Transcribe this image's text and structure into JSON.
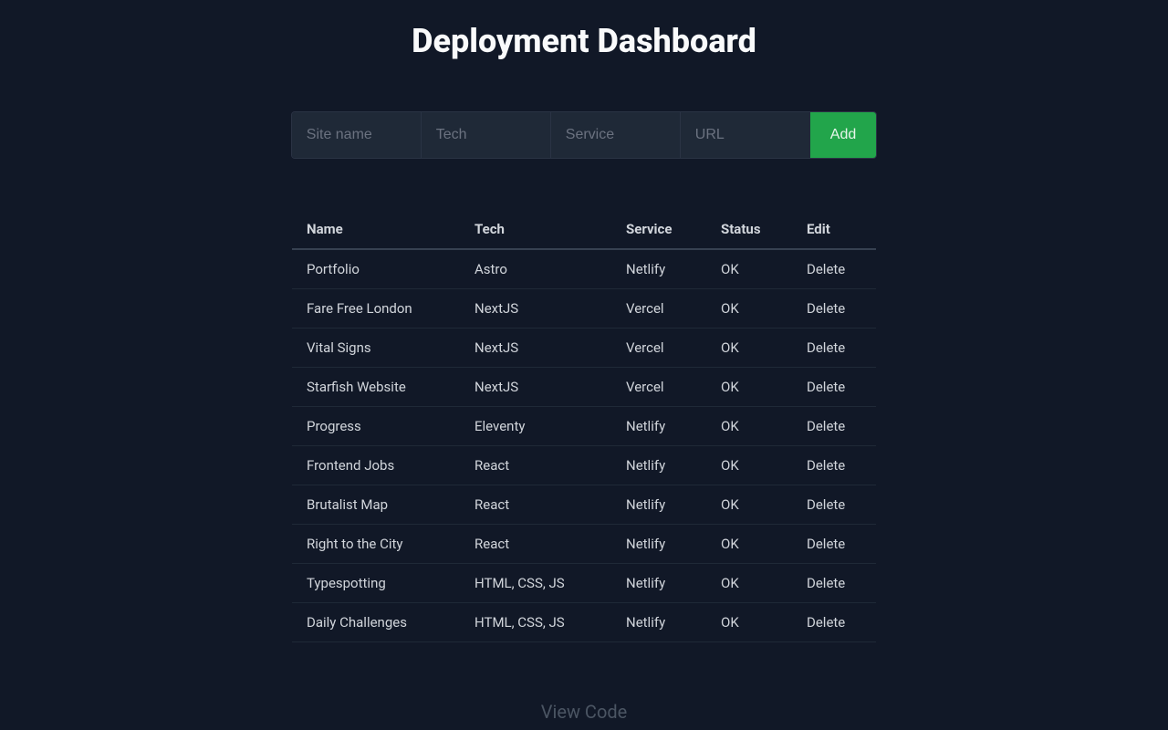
{
  "title": "Deployment Dashboard",
  "form": {
    "siteName": {
      "placeholder": "Site name",
      "value": ""
    },
    "tech": {
      "placeholder": "Tech",
      "value": ""
    },
    "service": {
      "placeholder": "Service",
      "value": ""
    },
    "url": {
      "placeholder": "URL",
      "value": ""
    },
    "addLabel": "Add"
  },
  "table": {
    "headers": {
      "name": "Name",
      "tech": "Tech",
      "service": "Service",
      "status": "Status",
      "edit": "Edit"
    },
    "deleteLabel": "Delete",
    "rows": [
      {
        "name": "Portfolio",
        "tech": "Astro",
        "service": "Netlify",
        "status": "OK"
      },
      {
        "name": "Fare Free London",
        "tech": "NextJS",
        "service": "Vercel",
        "status": "OK"
      },
      {
        "name": "Vital Signs",
        "tech": "NextJS",
        "service": "Vercel",
        "status": "OK"
      },
      {
        "name": "Starfish Website",
        "tech": "NextJS",
        "service": "Vercel",
        "status": "OK"
      },
      {
        "name": "Progress",
        "tech": "Eleventy",
        "service": "Netlify",
        "status": "OK"
      },
      {
        "name": "Frontend Jobs",
        "tech": "React",
        "service": "Netlify",
        "status": "OK"
      },
      {
        "name": "Brutalist Map",
        "tech": "React",
        "service": "Netlify",
        "status": "OK"
      },
      {
        "name": "Right to the City",
        "tech": "React",
        "service": "Netlify",
        "status": "OK"
      },
      {
        "name": "Typespotting",
        "tech": "HTML, CSS, JS",
        "service": "Netlify",
        "status": "OK"
      },
      {
        "name": "Daily Challenges",
        "tech": "HTML, CSS, JS",
        "service": "Netlify",
        "status": "OK"
      }
    ]
  },
  "footer": {
    "viewCode": "View Code"
  }
}
